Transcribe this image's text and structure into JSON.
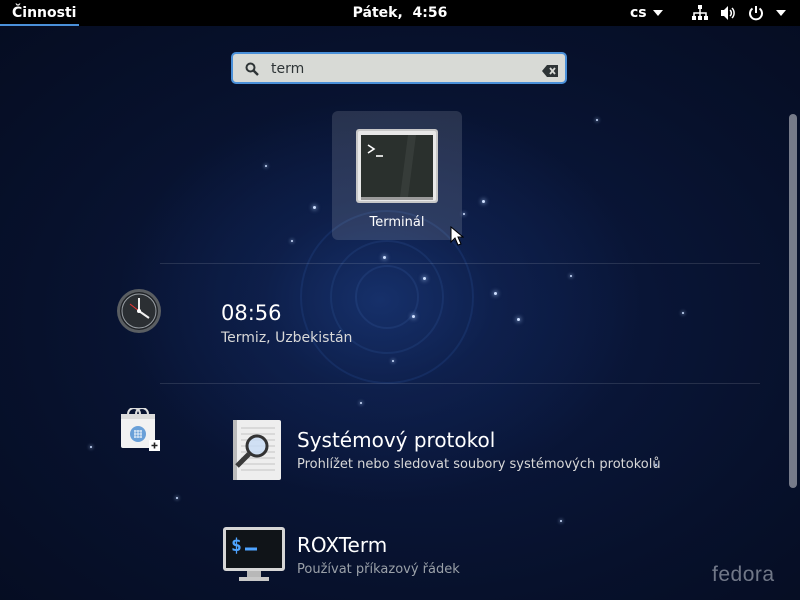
{
  "topbar": {
    "activities_label": "Činnosti",
    "clock": "Pátek,  4:56",
    "keyboard_layout": "cs",
    "icons": [
      "network-wired-icon",
      "volume-icon",
      "power-icon",
      "chevron-down-icon"
    ]
  },
  "search": {
    "value": "term",
    "icon": "search-icon",
    "clear_icon": "clear-text-icon"
  },
  "app_results": [
    {
      "label": "Terminál",
      "icon": "terminal-icon"
    }
  ],
  "clocks_result": {
    "provider_icon": "clocks-app-icon",
    "time": "08:56",
    "location": "Termiz, Uzbekistán"
  },
  "software_results": {
    "provider_icon": "software-app-icon",
    "items": [
      {
        "title": "Systémový protokol",
        "subtitle": "Prohlížet nebo sledovat soubory systémových protokolů",
        "icon": "system-log-icon"
      },
      {
        "title": "ROXTerm",
        "subtitle": "Používat příkazový řádek",
        "icon": "roxterm-icon"
      }
    ]
  },
  "watermark": "fedora",
  "colors": {
    "accent": "#4a90d9",
    "topbar": "#000000"
  }
}
